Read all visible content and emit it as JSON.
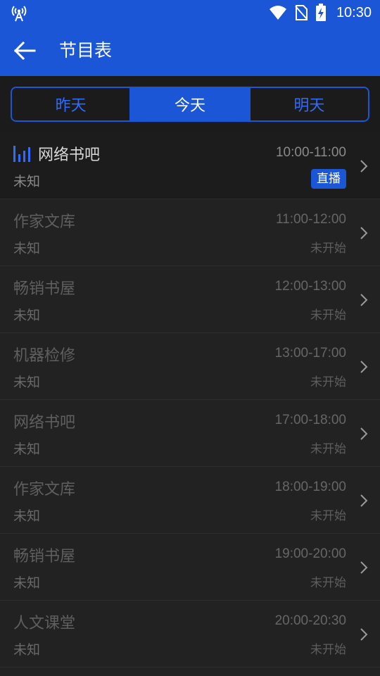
{
  "status_bar": {
    "time": "10:30",
    "icons": [
      "radio-tower-icon",
      "wifi-icon",
      "no-sim-icon",
      "battery-charging-icon"
    ]
  },
  "app_bar": {
    "back_icon": "arrow-left-icon",
    "title": "节目表"
  },
  "tabs": [
    {
      "label": "昨天",
      "active": false
    },
    {
      "label": "今天",
      "active": true
    },
    {
      "label": "明天",
      "active": false
    }
  ],
  "programs": [
    {
      "title": "网络书吧",
      "host": "未知",
      "time": "10:00-11:00",
      "status": "直播",
      "live": true
    },
    {
      "title": "作家文库",
      "host": "未知",
      "time": "11:00-12:00",
      "status": "未开始",
      "live": false
    },
    {
      "title": "畅销书屋",
      "host": "未知",
      "time": "12:00-13:00",
      "status": "未开始",
      "live": false
    },
    {
      "title": "机器检修",
      "host": "未知",
      "time": "13:00-17:00",
      "status": "未开始",
      "live": false
    },
    {
      "title": "网络书吧",
      "host": "未知",
      "time": "17:00-18:00",
      "status": "未开始",
      "live": false
    },
    {
      "title": "作家文库",
      "host": "未知",
      "time": "18:00-19:00",
      "status": "未开始",
      "live": false
    },
    {
      "title": "畅销书屋",
      "host": "未知",
      "time": "19:00-20:00",
      "status": "未开始",
      "live": false
    },
    {
      "title": "人文课堂",
      "host": "未知",
      "time": "20:00-20:30",
      "status": "未开始",
      "live": false
    }
  ],
  "colors": {
    "brand": "#1a56d6",
    "background": "#222222",
    "live_badge": "#1a56d6"
  }
}
